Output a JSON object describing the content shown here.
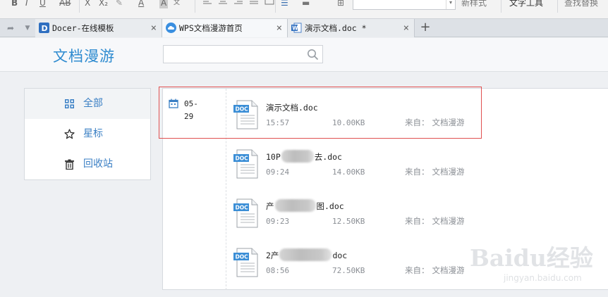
{
  "toolbar": {
    "style_label": "新样式",
    "text_tool_label": "文字工具",
    "find_replace_label": "查找替换",
    "bold_glyph": "B",
    "italic_glyph": "I",
    "underline_glyph": "U",
    "strike_glyph": "AB",
    "sup_glyph": "X",
    "sub_glyph": "X₂",
    "font_color_glyph": "A",
    "char_shade_glyph": "A"
  },
  "tabs": [
    {
      "label": "Docer-在线模板",
      "icon": "docer-icon",
      "close": "×",
      "active": false
    },
    {
      "label": "WPS文档漫游首页",
      "icon": "cloud-icon",
      "close": "×",
      "active": true
    },
    {
      "label": "演示文档.doc *",
      "icon": "word-doc-icon",
      "close": "×",
      "active": false
    }
  ],
  "tabbar": {
    "back_glyph": "➦",
    "menu_glyph": "▼",
    "add_glyph": "+"
  },
  "header": {
    "title": "文档漫游",
    "search_placeholder": ""
  },
  "sidebar": {
    "items": [
      {
        "label": "全部",
        "icon": "grid-icon",
        "active": true
      },
      {
        "label": "星标",
        "icon": "star-icon",
        "active": false
      },
      {
        "label": "回收站",
        "icon": "trash-icon",
        "active": false
      }
    ]
  },
  "date_group": {
    "date": "05-29"
  },
  "files": [
    {
      "name_before": "演示文档.doc",
      "name_after": "",
      "blurred": false,
      "time": "15:57",
      "size": "10.00KB",
      "source_label": "来自：",
      "source": "文档漫游",
      "icon_text": "DOC"
    },
    {
      "name_before": "10P",
      "name_after": "去.doc",
      "blurred": true,
      "time": "09:24",
      "size": "14.00KB",
      "source_label": "来自：",
      "source": "文档漫游",
      "icon_text": "DOC"
    },
    {
      "name_before": "产",
      "name_after": "图.doc",
      "blurred": true,
      "time": "09:23",
      "size": "12.50KB",
      "source_label": "来自：",
      "source": "文档漫游",
      "icon_text": "DOC"
    },
    {
      "name_before": "2产",
      "name_after": "doc",
      "blurred": true,
      "time": "08:56",
      "size": "72.50KB",
      "source_label": "来自：",
      "source": "文档漫游",
      "icon_text": "DOC"
    }
  ],
  "watermark": {
    "brand": "Baidu经验",
    "url": "jingyan.baidu.com"
  },
  "colors": {
    "accent": "#2e8bd0",
    "highlight_border": "#e05050",
    "doc_icon_blue": "#3b8ed6"
  }
}
